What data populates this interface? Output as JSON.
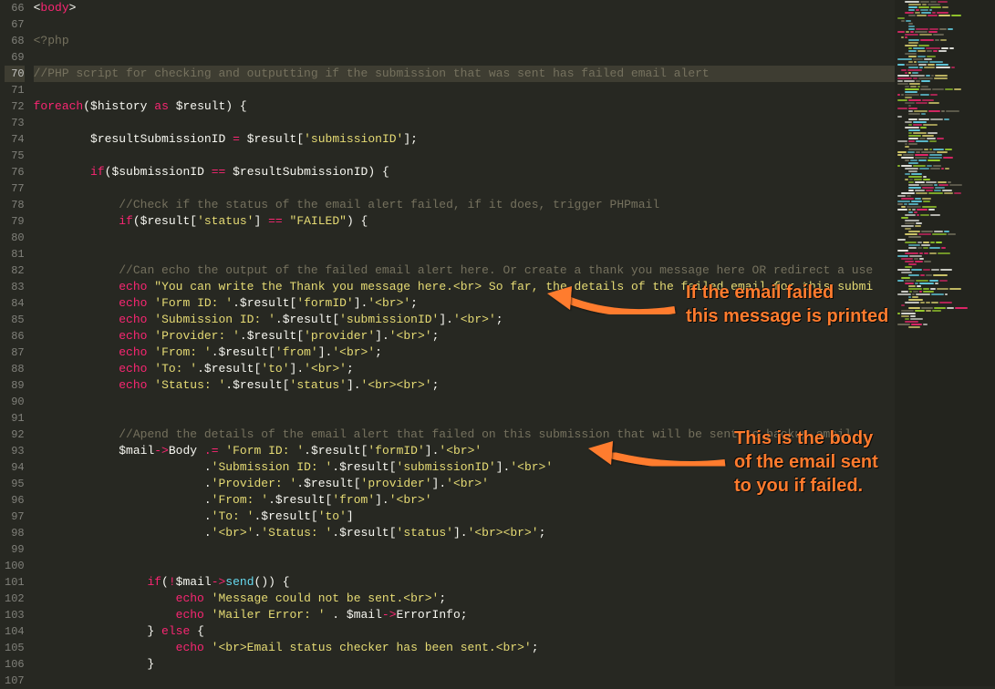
{
  "lines": {
    "start": 66,
    "end": 107,
    "highlighted": 70
  },
  "code": {
    "l66_tag": "body",
    "l68_php": "<?php",
    "l70_cmt": "//PHP script for checking and outputting if the submission that was sent has failed email alert",
    "l72_kw1": "foreach",
    "l72_var1": "$history",
    "l72_kw2": "as",
    "l72_var2": "$result",
    "l74_var1": "$resultSubmissionID",
    "l74_var2": "$result",
    "l74_key": "'submissionID'",
    "l76_kw": "if",
    "l76_var1": "$submissionID",
    "l76_var2": "$resultSubmissionID",
    "l78_cmt": "//Check if the status of the email alert failed, if it does, trigger PHPmail",
    "l79_kw": "if",
    "l79_var": "$result",
    "l79_key": "'status'",
    "l79_str": "\"FAILED\"",
    "l82_cmt": "//Can echo the output of the failed email alert here. Or create a thank you message here OR redirect a use",
    "l83_kw": "echo",
    "l83_str": "\"You can write the Thank you message here.<br> So far, the details of the failed email for this submi",
    "l84_kw": "echo",
    "l84_s1": "'Form ID: '",
    "l84_var": "$result",
    "l84_key": "'formID'",
    "l84_s2": "'<br>'",
    "l85_kw": "echo",
    "l85_s1": "'Submission ID: '",
    "l85_var": "$result",
    "l85_key": "'submissionID'",
    "l85_s2": "'<br>'",
    "l86_kw": "echo",
    "l86_s1": "'Provider: '",
    "l86_var": "$result",
    "l86_key": "'provider'",
    "l86_s2": "'<br>'",
    "l87_kw": "echo",
    "l87_s1": "'From: '",
    "l87_var": "$result",
    "l87_key": "'from'",
    "l87_s2": "'<br>'",
    "l88_kw": "echo",
    "l88_s1": "'To: '",
    "l88_var": "$result",
    "l88_key": "'to'",
    "l88_s2": "'<br>'",
    "l89_kw": "echo",
    "l89_s1": "'Status: '",
    "l89_var": "$result",
    "l89_key": "'status'",
    "l89_s2": "'<br><br>'",
    "l92_cmt": "//Apend the details of the email alert that failed on this submission that will be sent to backup email",
    "l93_var1": "$mail",
    "l93_prop": "Body",
    "l93_s1": "'Form ID: '",
    "l93_var2": "$result",
    "l93_key": "'formID'",
    "l93_s2": "'<br>'",
    "l94_s1": "'Submission ID: '",
    "l94_var": "$result",
    "l94_key": "'submissionID'",
    "l94_s2": "'<br>'",
    "l95_s1": "'Provider: '",
    "l95_var": "$result",
    "l95_key": "'provider'",
    "l95_s2": "'<br>'",
    "l96_s1": "'From: '",
    "l96_var": "$result",
    "l96_key": "'from'",
    "l96_s2": "'<br>'",
    "l97_s1": "'To: '",
    "l97_var": "$result",
    "l97_key": "'to'",
    "l98_s1": "'<br>'",
    "l98_s2": "'Status: '",
    "l98_var": "$result",
    "l98_key": "'status'",
    "l98_s3": "'<br><br>'",
    "l101_kw": "if",
    "l101_var": "$mail",
    "l101_func": "send",
    "l102_kw": "echo",
    "l102_str": "'Message could not be sent.<br>'",
    "l103_kw": "echo",
    "l103_s1": "'Mailer Error: '",
    "l103_var": "$mail",
    "l103_prop": "ErrorInfo",
    "l104_kw": "else",
    "l105_kw": "echo",
    "l105_str": "'<br>Email status checker has been sent.<br>'"
  },
  "annotations": {
    "a1_l1": "If the email failed",
    "a1_l2": "this message is printed",
    "a2_l1": "This is the body",
    "a2_l2": "of the email sent",
    "a2_l3": "to you if failed."
  }
}
